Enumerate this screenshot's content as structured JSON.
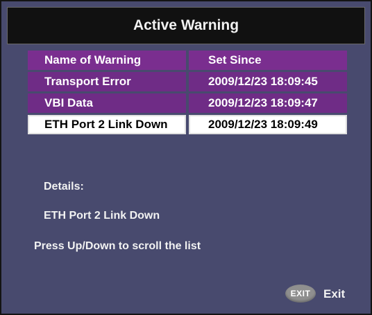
{
  "title": "Active Warning",
  "table": {
    "headers": {
      "name": "Name of Warning",
      "since": "Set Since"
    },
    "rows": [
      {
        "name": "Transport Error",
        "since": "2009/12/23 18:09:45"
      },
      {
        "name": "VBI Data",
        "since": "2009/12/23 18:09:47"
      },
      {
        "name": "ETH Port 2 Link Down",
        "since": "2009/12/23 18:09:49",
        "selected": true
      }
    ]
  },
  "details": {
    "label": "Details:",
    "value": "ETH Port 2 Link Down"
  },
  "hint": "Press Up/Down to scroll the list",
  "footer": {
    "exit_key": "EXIT",
    "exit_label": "Exit"
  },
  "colors": {
    "background": "#484a6e",
    "title_bar": "#111111",
    "row": "#6f2c86",
    "selected_row": "#ffffff"
  }
}
